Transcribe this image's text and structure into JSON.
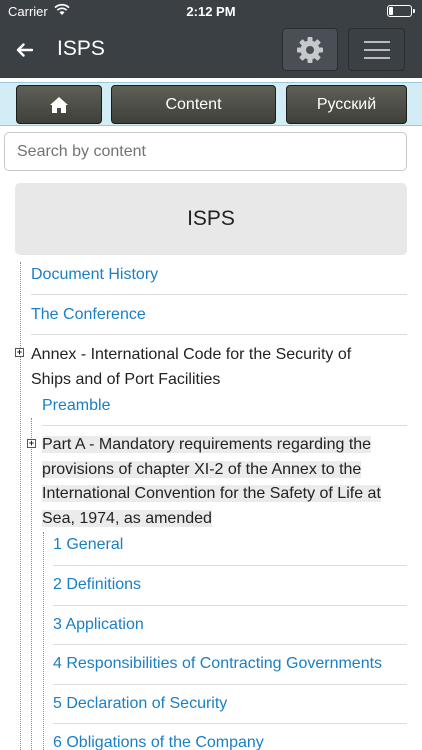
{
  "status_bar": {
    "carrier": "Carrier",
    "time": "2:12 PM"
  },
  "nav": {
    "title": "ISPS",
    "back_icon": "arrow-left-icon",
    "settings_icon": "gear-icon",
    "menu_icon": "hamburger-menu-icon"
  },
  "toolbar": {
    "home_icon": "home-icon",
    "content_label": "Content",
    "language_label": "Русский"
  },
  "search": {
    "placeholder": "Search by content",
    "value": ""
  },
  "doc": {
    "title": "ISPS"
  },
  "tree": {
    "document_history": "Document History",
    "the_conference": "The Conference",
    "annex": {
      "lines": [
        "Annex - International Code for the Security of",
        "Ships and of Port Facilities"
      ],
      "preamble": "Preamble",
      "part_a": {
        "lines": [
          "Part A - Mandatory requirements regarding the",
          "provisions of chapter XI-2 of the Annex to the",
          "International Convention for the Safety of Life at",
          "Sea, 1974, as amended"
        ],
        "items": [
          "1 General",
          "2 Definitions",
          "3 Application",
          "4 Responsibilities of Contracting Governments",
          "5 Declaration of Security",
          "6 Obligations of the Company"
        ]
      }
    }
  },
  "colors": {
    "bar": "#3b4045",
    "toolbar_bg": "#d3edf7",
    "link": "#1a7fc4"
  }
}
